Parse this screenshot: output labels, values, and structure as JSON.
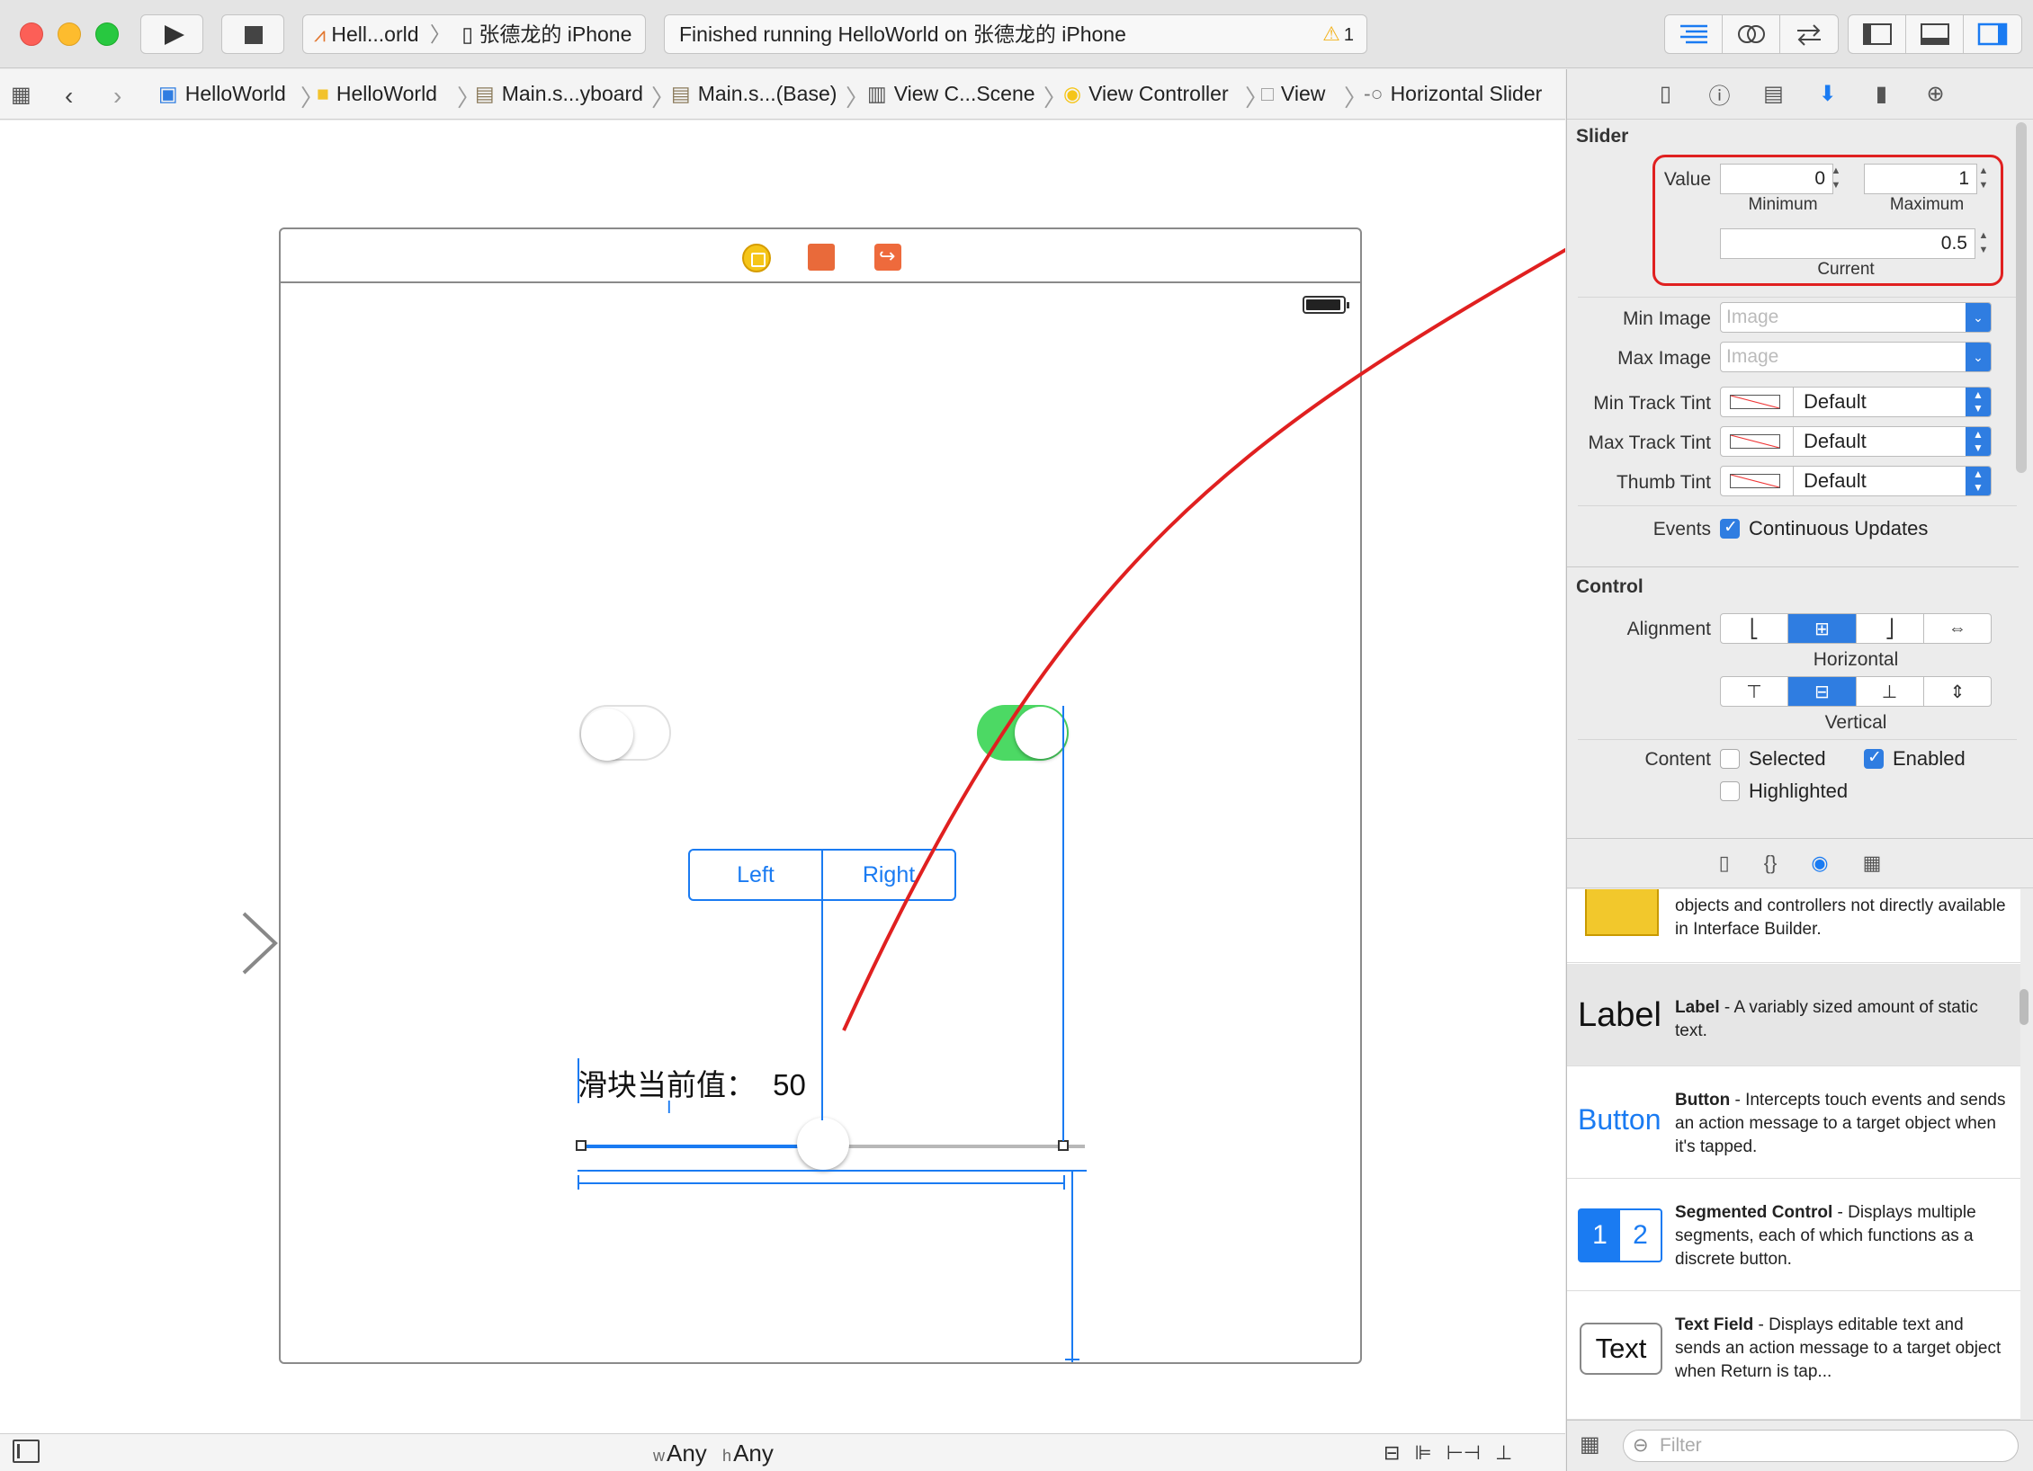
{
  "toolbar": {
    "scheme_target": "Hell...orld",
    "scheme_device": "张德龙的 iPhone",
    "status_text": "Finished running HelloWorld on 张德龙的 iPhone",
    "warning_count": "1"
  },
  "jumpbar": {
    "items": [
      "HelloWorld",
      "HelloWorld",
      "Main.s...yboard",
      "Main.s...(Base)",
      "View C...Scene",
      "View Controller",
      "View",
      "Horizontal Slider"
    ]
  },
  "canvas": {
    "segment_left": "Left",
    "segment_right": "Right",
    "slider_label": "滑块当前值：",
    "slider_value_label": "50",
    "switch_left_on": false,
    "switch_right_on": true,
    "slider_fraction": 0.5,
    "size_class_w_prefix": "w",
    "size_class_w": "Any",
    "size_class_h_prefix": "h",
    "size_class_h": "Any"
  },
  "inspector": {
    "slider_section": "Slider",
    "value_label": "Value",
    "minimum": "0",
    "minimum_label": "Minimum",
    "maximum": "1",
    "maximum_label": "Maximum",
    "current": "0.5",
    "current_label": "Current",
    "min_image_label": "Min Image",
    "min_image_placeholder": "Image",
    "max_image_label": "Max Image",
    "max_image_placeholder": "Image",
    "min_track_tint_label": "Min Track Tint",
    "min_track_tint": "Default",
    "max_track_tint_label": "Max Track Tint",
    "max_track_tint": "Default",
    "thumb_tint_label": "Thumb Tint",
    "thumb_tint": "Default",
    "events_label": "Events",
    "continuous_updates": "Continuous Updates",
    "control_section": "Control",
    "alignment_label": "Alignment",
    "horizontal_label": "Horizontal",
    "vertical_label": "Vertical",
    "content_label": "Content",
    "selected": "Selected",
    "enabled": "Enabled",
    "highlighted": "Highlighted"
  },
  "library": {
    "items": [
      {
        "title": "",
        "desc": "objects and controllers not directly available in Interface Builder."
      },
      {
        "icon": "Label",
        "title": "Label",
        "desc": " - A variably sized amount of static text."
      },
      {
        "icon": "Button",
        "title": "Button",
        "desc": " - Intercepts touch events and sends an action message to a target object when it's tapped."
      },
      {
        "icon_a": "1",
        "icon_b": "2",
        "title": "Segmented Control",
        "desc": " - Displays multiple segments, each of which functions as a discrete button."
      },
      {
        "icon": "Text",
        "title": "Text Field",
        "desc": " - Displays editable text and sends an action message to a target object when Return is tap..."
      }
    ],
    "filter_placeholder": "Filter"
  },
  "colors": {
    "accent": "#1a7bf2",
    "switch_on": "#4cd964",
    "annotation": "#e02020"
  }
}
